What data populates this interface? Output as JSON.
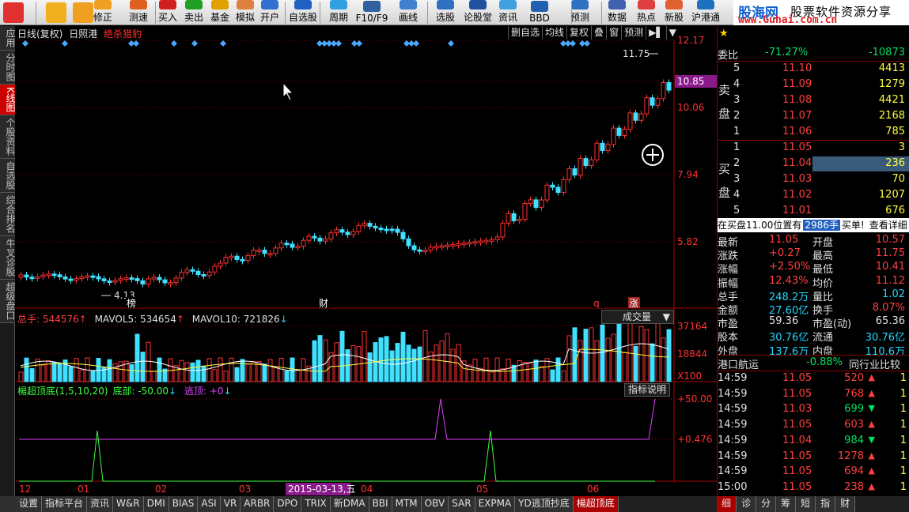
{
  "toolbar": {
    "items": [
      "修正",
      "测速",
      "买入",
      "卖出",
      "基金",
      "模拟",
      "开户",
      "自选股",
      "周期",
      "F10/F9",
      "画线",
      "选股",
      "论股堂",
      "资讯",
      "BBD",
      "预测",
      "数据",
      "热点",
      "新股",
      "沪港通"
    ],
    "brand_main": "股海网",
    "brand_sub": "股票软件资源分享",
    "brand_url": "www.Guhai.com.cn"
  },
  "left_tabs": [
    "应用",
    "分时图",
    "K线图",
    "个股资料",
    "自选股",
    "综合排名",
    "牛叉诊股",
    "超级盘口"
  ],
  "chart_header": {
    "period": "日线(复权)",
    "stock": "日照港",
    "tag": "绝杀猎豹",
    "buttons": [
      "删自选",
      "均线",
      "复权",
      "叠",
      "窗",
      "预测"
    ]
  },
  "price_axis": [
    "12.17",
    "10.85",
    "10.06",
    "7.94",
    "5.82"
  ],
  "price_labels": {
    "high": "11.75",
    "low": "4.13",
    "current": "10.85"
  },
  "markers": [
    "榜",
    "财",
    "q",
    "涨"
  ],
  "volume_header": {
    "label": "总手:",
    "value": "544576",
    "ma5_label": "MAVOL5:",
    "ma5": "534654",
    "ma10_label": "MAVOL10:",
    "ma10": "721826",
    "selector": "成交量"
  },
  "volume_axis": [
    "37164",
    "18844",
    "X100"
  ],
  "indicator_header": {
    "name": "楊超顶底(1,5,10,20)",
    "bottom_label": "底部:",
    "bottom_value": "-50.00",
    "top_label": "逃顶:",
    "top_value": "+0",
    "help": "指标说明"
  },
  "indicator_axis": [
    "+50.00",
    "+0.476"
  ],
  "date_axis": [
    "12",
    "01",
    "02",
    "03",
    "2015-03-13,五",
    "04",
    "05",
    "06"
  ],
  "order_book": {
    "wei_label": "委比",
    "wei_bi": "-71.27%",
    "wei_cha": "-10873",
    "sell_label": "卖盘",
    "buy_label": "买盘",
    "sell": [
      {
        "lvl": "5",
        "price": "11.10",
        "vol": "4413"
      },
      {
        "lvl": "4",
        "price": "11.09",
        "vol": "1279"
      },
      {
        "lvl": "3",
        "price": "11.08",
        "vol": "4421"
      },
      {
        "lvl": "2",
        "price": "11.07",
        "vol": "2168"
      },
      {
        "lvl": "1",
        "price": "11.06",
        "vol": "785"
      }
    ],
    "buy": [
      {
        "lvl": "1",
        "price": "11.05",
        "vol": "3"
      },
      {
        "lvl": "2",
        "price": "11.04",
        "vol": "236"
      },
      {
        "lvl": "3",
        "price": "11.03",
        "vol": "70"
      },
      {
        "lvl": "4",
        "price": "11.02",
        "vol": "1207"
      },
      {
        "lvl": "5",
        "price": "11.01",
        "vol": "676"
      }
    ],
    "notice_text": "在买盘11.00位置有",
    "notice_vol": "2986手",
    "notice_action": "买单!",
    "notice_link": "查看详细"
  },
  "quote": [
    {
      "l1": "最新",
      "v1": "11.05",
      "l2": "开盘",
      "v2": "10.57"
    },
    {
      "l1": "涨跌",
      "v1": "+0.27",
      "l2": "最高",
      "v2": "11.75"
    },
    {
      "l1": "涨幅",
      "v1": "+2.50%",
      "l2": "最低",
      "v2": "10.41"
    },
    {
      "l1": "振幅",
      "v1": "12.43%",
      "l2": "均价",
      "v2": "11.12"
    },
    {
      "l1": "总手",
      "v1": "248.2万",
      "l2": "量比",
      "v2": "1.02"
    },
    {
      "l1": "金额",
      "v1": "27.60亿",
      "l2": "换手",
      "v2": "8.07%"
    },
    {
      "l1": "市盈",
      "v1": "59.36",
      "l2": "市盈(动)",
      "v2": "65.36"
    },
    {
      "l1": "股本",
      "v1": "30.76亿",
      "l2": "流通",
      "v2": "30.76亿"
    },
    {
      "l1": "外盘",
      "v1": "137.6万",
      "l2": "内盘",
      "v2": "110.6万"
    }
  ],
  "sector": {
    "name": "港口航运",
    "change": "-0.88%",
    "compare": "同行业比较"
  },
  "ticks": [
    {
      "time": "14:59",
      "price": "11.05",
      "vol": "520",
      "dir": "up",
      "n": "1"
    },
    {
      "time": "14:59",
      "price": "11.05",
      "vol": "768",
      "dir": "up",
      "n": "1"
    },
    {
      "time": "14:59",
      "price": "11.03",
      "vol": "699",
      "dir": "down",
      "n": "1"
    },
    {
      "time": "14:59",
      "price": "11.05",
      "vol": "603",
      "dir": "up",
      "n": "1"
    },
    {
      "time": "14:59",
      "price": "11.04",
      "vol": "984",
      "dir": "down",
      "n": "1"
    },
    {
      "time": "14:59",
      "price": "11.05",
      "vol": "1278",
      "dir": "up",
      "n": "1"
    },
    {
      "time": "14:59",
      "price": "11.05",
      "vol": "694",
      "dir": "up",
      "n": "1"
    },
    {
      "time": "15:00",
      "price": "11.05",
      "vol": "238",
      "dir": "up",
      "n": "1"
    }
  ],
  "bottom_tabs": [
    "设置",
    "指标平台",
    "资讯",
    "W&R",
    "DMI",
    "BIAS",
    "ASI",
    "VR",
    "ARBR",
    "DPO",
    "TRIX",
    "新DMA",
    "BBI",
    "MTM",
    "OBV",
    "SAR",
    "EXPMA",
    "YD逃顶抄底",
    "楊超顶底"
  ],
  "right_tabs": [
    "细",
    "诊",
    "分",
    "筹",
    "短",
    "指",
    "财"
  ]
}
